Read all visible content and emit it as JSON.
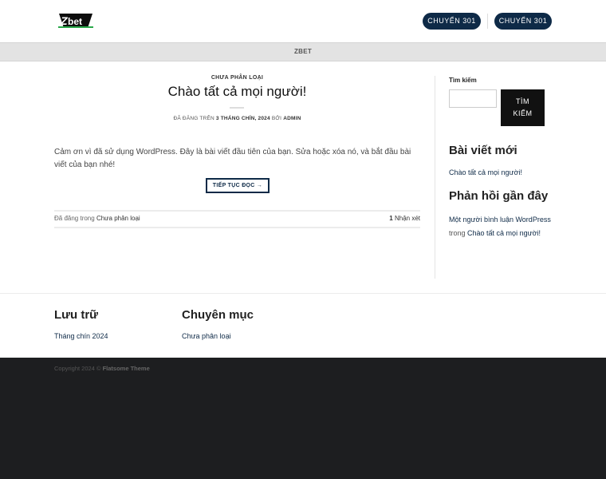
{
  "header": {
    "logo_alt": "Zbet",
    "nav": [
      {
        "label": "CHUYỂN 301"
      },
      {
        "label": "CHUYỂN 301"
      }
    ]
  },
  "subbar": {
    "label": "ZBET"
  },
  "post": {
    "category": "CHƯA PHÂN LOẠI",
    "title": "Chào tất cả mọi người!",
    "meta_prefix": "ĐÃ ĐĂNG TRÊN",
    "meta_date": "3 THÁNG CHÍN, 2024",
    "meta_by": "BỞI",
    "meta_author": "ADMIN",
    "excerpt": "Cảm ơn vì đã sử dụng WordPress. Đây là bài viết đầu tiên của bạn. Sửa hoặc xóa nó, và bắt đầu bài viết của bạn nhé!",
    "read_more": "TIẾP TỤC ĐỌC →",
    "footer_prefix": "Đã đăng trong",
    "footer_category": "Chưa phân loại",
    "comments_count": "1",
    "comments_label": "Nhận xét"
  },
  "sidebar": {
    "search_label": "Tìm kiếm",
    "search_placeholder": "",
    "search_button_line1": "TÌM",
    "search_button_line2": "KIẾM",
    "recent_posts_title": "Bài viết mới",
    "recent_post_1": "Chào tất cả mọi người!",
    "recent_comments_title": "Phản hồi gần đây",
    "comment_author": "Một người bình luận WordPress",
    "comment_on": "trong",
    "comment_post": "Chào tất cả mọi người!"
  },
  "widgets": {
    "archive_title": "Lưu trữ",
    "archive_link": "Tháng chín 2024",
    "categories_title": "Chuyên mục",
    "categories_link": "Chưa phân loại"
  },
  "footer": {
    "copyright_prefix": "Copyright 2024 ©",
    "theme": "Flatsome Theme"
  },
  "colors": {
    "accent": "#0e2a47",
    "subbar": "#e3e3e3",
    "footer_bg": "#1d1e20"
  }
}
